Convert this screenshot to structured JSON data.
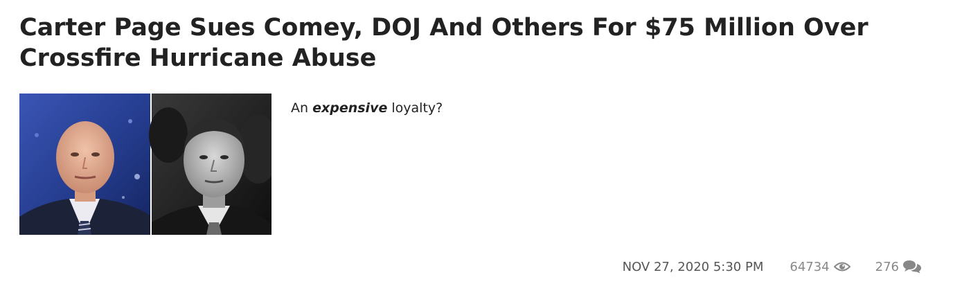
{
  "article": {
    "title": "Carter Page Sues Comey, DOJ And Others For $75 Million Over Crossfire Hurricane Abuse",
    "teaser_before": "An ",
    "teaser_emphasis": "expensive",
    "teaser_after": " loyalty?",
    "date": "NOV 27, 2020 5:30 PM",
    "views": "64734",
    "comments": "276",
    "thumbnail": {
      "left_panel": "portrait-photo-on-blue-studio-background",
      "right_panel": "black-and-white-portrait-photo"
    }
  },
  "icons": {
    "views": "eye-icon",
    "comments": "speech-bubbles-icon"
  },
  "colors": {
    "title": "#222222",
    "date": "#555555",
    "meta": "#888888",
    "thumb_left_bg": "#2a3f8f"
  }
}
